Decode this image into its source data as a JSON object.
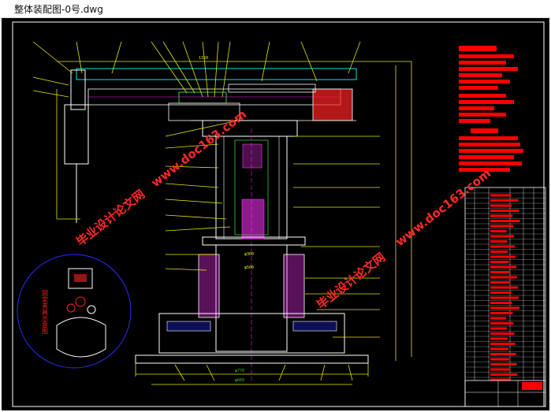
{
  "window": {
    "title": "整体装配图-0号.dwg"
  },
  "drawing": {
    "watermarks": [
      "毕业设计论文网",
      "www.doc163.com"
    ],
    "detail_label": "固定夹具示意图",
    "dimensions": {
      "bottom_1": "φ770",
      "bottom_2": "φ660",
      "mid_1": "φ360",
      "mid_2": "φ500",
      "top_span": "1350"
    }
  },
  "colors": {
    "background": "#000000",
    "frame": "#ffffff",
    "lines": "#e6e600",
    "cyan": "#00e5e5",
    "green": "#33cc33",
    "magenta": "#ff33ff",
    "red": "#ff0000",
    "blue": "#2b2bff"
  }
}
